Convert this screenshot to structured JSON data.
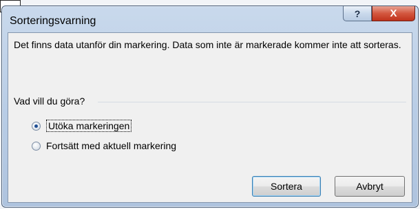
{
  "dialog": {
    "title": "Sorteringsvarning",
    "help_label": "?",
    "close_label": "X",
    "message": "Det finns data utanför din markering. Data som inte är markerade kommer inte att sorteras.",
    "group_label": "Vad vill du göra?",
    "options": [
      {
        "label": "Utöka markeringen",
        "selected": true
      },
      {
        "label": "Fortsätt med aktuell markering",
        "selected": false
      }
    ],
    "buttons": {
      "primary": "Sortera",
      "cancel": "Avbryt"
    }
  }
}
